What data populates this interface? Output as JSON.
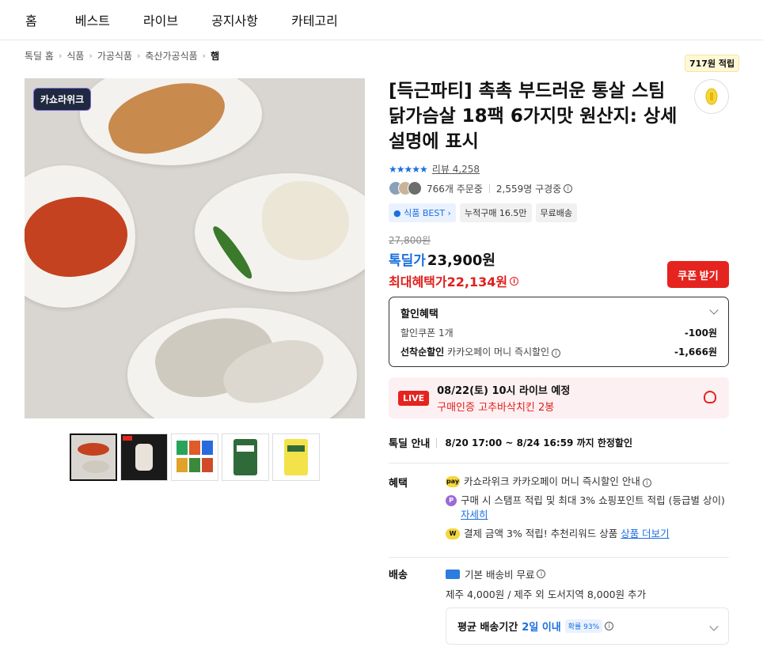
{
  "nav": [
    "홈",
    "베스트",
    "라이브",
    "공지사항",
    "카테고리"
  ],
  "breadcrumb": [
    "톡딜 홈",
    "식품",
    "가공식품",
    "축산가공식품",
    "햄"
  ],
  "product": {
    "badge": "카쇼라위크",
    "title": "[득근파티] 촉촉 부드러운 통살 스팀닭가슴살 18팩 6가지맛 원산지: 상세설명에 표시",
    "point_badge": "717원 적립",
    "rating_stars": "★★★★★",
    "review_label": "리뷰 4,258",
    "orders": "766개 주문중",
    "subscribers": "2,559명 구경중",
    "tags": [
      "식품 BEST",
      "누적구매 16.5만",
      "무료배송"
    ],
    "original_price": "27,800원",
    "deal_label": "톡딜가",
    "deal_price": "23,900원",
    "max_label": "최대혜택가",
    "max_price": "22,134원",
    "coupon_button": "쿠폰 받기"
  },
  "discount": {
    "title": "할인혜택",
    "rows": [
      {
        "label": "할인쿠폰 1개",
        "bold": "",
        "value": "-100원"
      },
      {
        "label": "카카오페이 머니 즉시할인",
        "bold": "선착순할인",
        "value": "-1,666원"
      }
    ]
  },
  "live": {
    "badge": "LIVE",
    "line1": "08/22(토) 10시 라이브 예정",
    "line2": "구매인증 고추바삭치킨 2봉"
  },
  "notice": {
    "label": "톡딜 안내",
    "text": "8/20 17:00 ~ 8/24 16:59 까지 한정할인"
  },
  "benefit": {
    "label": "혜택",
    "items": [
      {
        "icon": "pay",
        "text": "카쇼라위크 카카오페이 머니 즉시할인 안내",
        "link": ""
      },
      {
        "icon": "P",
        "text": "구매 시 스탬프 적립 및 최대 3% 쇼핑포인트 적립 (등급별 상이)",
        "link": "자세히"
      },
      {
        "icon": "W",
        "text": "결제 금액 3% 적립! 추천리워드 상품",
        "link": "상품 더보기"
      }
    ]
  },
  "shipping": {
    "label": "배송",
    "line1": "기본 배송비 무료",
    "line2": "제주 4,000원 / 제주 외 도서지역 8,000원 추가",
    "avg_label": "평균 배송기간",
    "avg_value": "2일 이내",
    "avg_pct": "확률 93%"
  },
  "colors": {
    "accent_blue": "#1b6fe0",
    "accent_red": "#e5231f"
  }
}
